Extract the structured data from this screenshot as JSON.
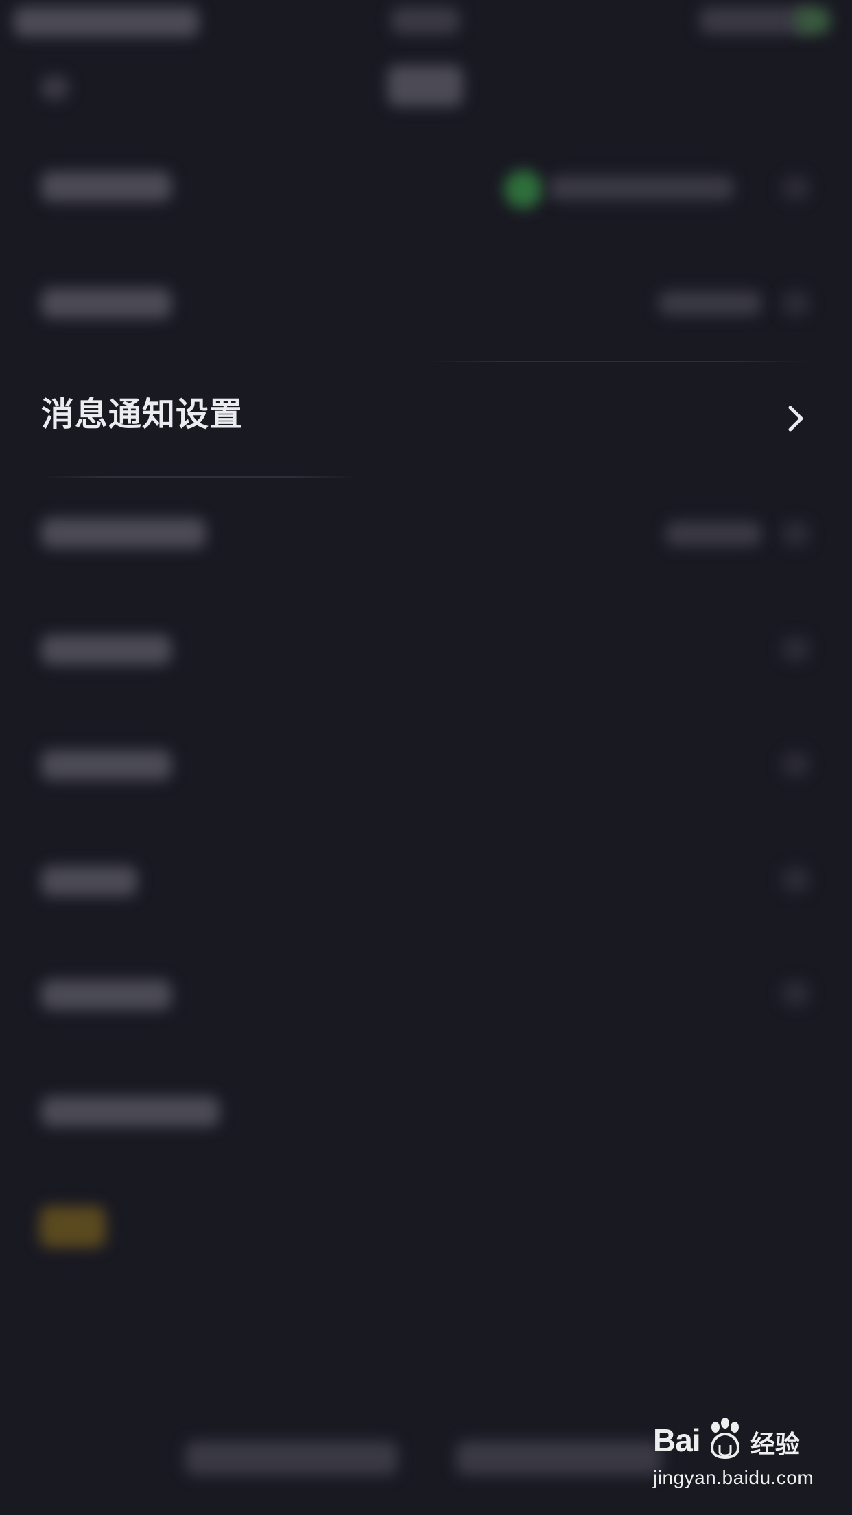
{
  "settings": {
    "focused_item": {
      "label": "消息通知设置",
      "icon": "chevron-right-icon"
    }
  },
  "watermark": {
    "brand": "Bai",
    "brand_suffix": "经验",
    "url": "jingyan.baidu.com"
  }
}
